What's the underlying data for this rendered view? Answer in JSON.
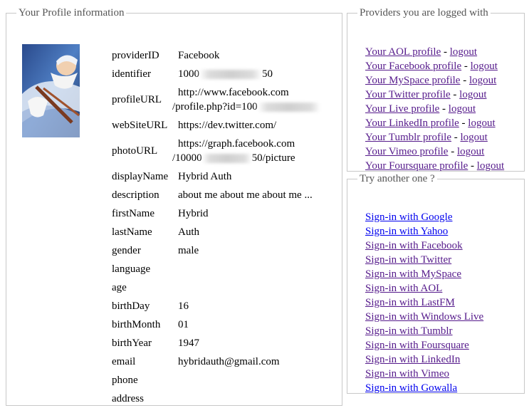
{
  "profile": {
    "legend": "Your Profile information",
    "fields": [
      {
        "key": "providerID",
        "value": "Facebook"
      },
      {
        "key": "identifier",
        "value": "1000",
        "value_end": "50"
      },
      {
        "key": "profileURL",
        "line1": "http://www.facebook.com",
        "line2_start": "/profile.php?id=100"
      },
      {
        "key": "webSiteURL",
        "value": "https://dev.twitter.com/"
      },
      {
        "key": "photoURL",
        "line1": "https://graph.facebook.com",
        "line2_start": "/10000",
        "line2_end": "50/picture"
      },
      {
        "key": "displayName",
        "value": "Hybrid Auth"
      },
      {
        "key": "description",
        "value": "about me about me about me ..."
      },
      {
        "key": "firstName",
        "value": "Hybrid"
      },
      {
        "key": "lastName",
        "value": "Auth"
      },
      {
        "key": "gender",
        "value": "male"
      },
      {
        "key": "language",
        "value": ""
      },
      {
        "key": "age",
        "value": ""
      },
      {
        "key": "birthDay",
        "value": "16"
      },
      {
        "key": "birthMonth",
        "value": "01"
      },
      {
        "key": "birthYear",
        "value": "1947"
      },
      {
        "key": "email",
        "value": "hybridauth@gmail.com"
      },
      {
        "key": "phone",
        "value": ""
      },
      {
        "key": "address",
        "value": ""
      }
    ]
  },
  "providers": {
    "legend": "Providers you are logged with",
    "logout_label": "logout",
    "separator": " - ",
    "items": [
      "Your AOL profile",
      "Your Facebook profile",
      "Your MySpace profile",
      "Your Twitter profile",
      "Your Live profile",
      "Your LinkedIn profile",
      "Your Tumblr profile",
      "Your Vimeo profile",
      "Your Foursquare profile"
    ]
  },
  "another": {
    "legend": "Try another one ?",
    "items": [
      {
        "label": "Sign-in with Google",
        "visited": false
      },
      {
        "label": "Sign-in with Yahoo",
        "visited": false
      },
      {
        "label": "Sign-in with Facebook",
        "visited": true
      },
      {
        "label": "Sign-in with Twitter",
        "visited": true
      },
      {
        "label": "Sign-in with MySpace",
        "visited": true
      },
      {
        "label": "Sign-in with AOL",
        "visited": true
      },
      {
        "label": "Sign-in with LastFM",
        "visited": true
      },
      {
        "label": "Sign-in with Windows Live",
        "visited": true
      },
      {
        "label": "Sign-in with Tumblr",
        "visited": true
      },
      {
        "label": "Sign-in with Foursquare",
        "visited": true
      },
      {
        "label": "Sign-in with LinkedIn",
        "visited": true
      },
      {
        "label": "Sign-in with Vimeo",
        "visited": true
      },
      {
        "label": "Sign-in with Gowalla",
        "visited": false
      }
    ]
  },
  "colors": {
    "link": "#0000ee",
    "visited": "#551a8b",
    "border": "#c8c8c8",
    "legend": "#555555"
  }
}
